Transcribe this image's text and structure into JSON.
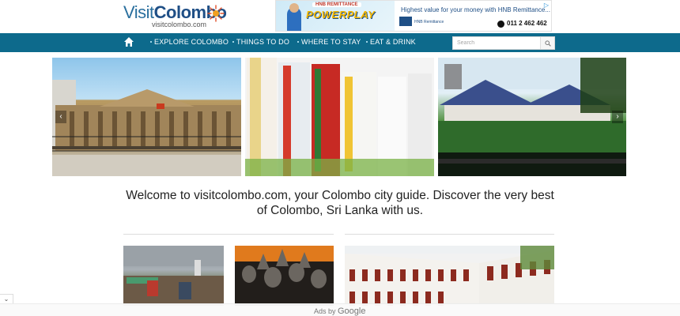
{
  "logo": {
    "main": "Visit",
    "accent": "Colombo",
    "subtext": "visitcolombo.com"
  },
  "top_ad": {
    "tag": "HNB REMITTANCE",
    "product": "POWERPLAY",
    "headline": "Highest value for your money with HNB Remittance...",
    "bank": "HNB",
    "bank_sub": "Remittance",
    "phone": "011 2 462 462",
    "choices_icon": "ad-choices-icon"
  },
  "nav": {
    "home_icon": "home-icon",
    "items": [
      "EXPLORE COLOMBO",
      "THINGS TO DO",
      "WHERE TO STAY",
      "EAT & DRINK"
    ],
    "search_placeholder": "Search",
    "search_icon": "search-icon"
  },
  "slider": {
    "slides": [
      "colonial-building-photo",
      "flower-garlands-photo",
      "lake-temple-photo"
    ],
    "prev_icon": "chevron-left-icon",
    "next_icon": "chevron-right-icon"
  },
  "welcome": "Welcome to visitcolombo.com, your Colombo city guide. Discover the very best of Colombo, Sri Lanka with us.",
  "cards": [
    "market-scene-photo",
    "buddha-statues-photo",
    "colonial-arcade-photo"
  ],
  "bottom_ad": {
    "prefix": "Ads by",
    "brand": "Google",
    "collapse_icon": "chevron-down-icon"
  },
  "colors": {
    "nav_bg": "#0d6a8c",
    "logo_blue": "#1f4f86",
    "powerplay_yellow": "#f5b800"
  }
}
